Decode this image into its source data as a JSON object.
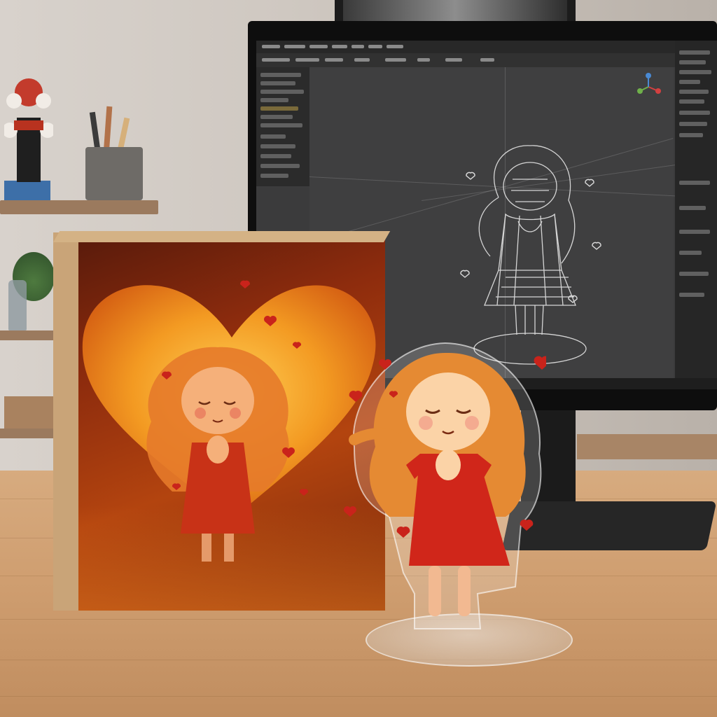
{
  "scene": {
    "description_items": [
      "desk-surface",
      "monitor",
      "product-box",
      "acrylic-standee"
    ],
    "colors": {
      "wall": "#d2cbc4",
      "desk": "#cf9e70",
      "monitor_bezel": "#0e0e0e",
      "screen_ui": "#3b3b3c",
      "box_orange": "#e8801c",
      "box_dark": "#5a1b0c",
      "dress_red": "#d0261a",
      "hair_orange": "#e58a33",
      "heart_red": "#c9231b",
      "wireframe": "#e6e6e6"
    },
    "icons": {
      "viewport_gizmo": "axis-gizmo-icon",
      "floating_hearts": "heart-icon"
    }
  }
}
